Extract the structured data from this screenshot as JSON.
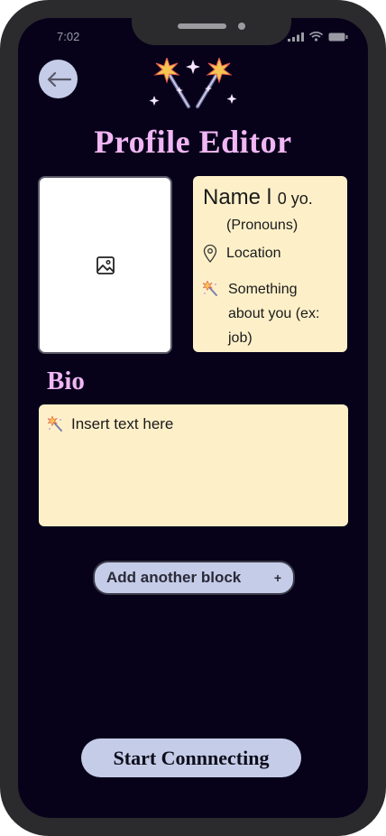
{
  "status_bar": {
    "time": "7:02"
  },
  "header": {
    "title": "Profile Editor"
  },
  "profile_card": {
    "name": "Name l",
    "age": "0 yo.",
    "pronouns": "(Pronouns)",
    "location": "Location",
    "about": "Something about you (ex: job)"
  },
  "bio": {
    "label": "Bio",
    "placeholder": "Insert text here"
  },
  "actions": {
    "add_block_label": "Add another block",
    "add_block_symbol": "+",
    "start_label": "Start Connnecting"
  },
  "colors": {
    "background": "#07021a",
    "accent_pink": "#f1b6f4",
    "card_cream": "#fdf0c9",
    "button_blue": "#c5cce8"
  }
}
